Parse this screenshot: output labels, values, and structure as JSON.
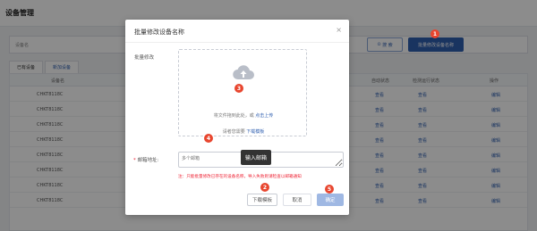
{
  "app": {
    "title": "设备管理",
    "filter_label": "设备名",
    "search_label": "搜 索",
    "batch_button_label": "批量修改设备名称",
    "tabs": [
      "已有设备",
      "新加设备"
    ],
    "table_header": [
      "设备名",
      "自动状态",
      "检测运行状态",
      "操作"
    ],
    "rows": [
      {
        "name": "CHKT8118C",
        "op": "编辑"
      },
      {
        "name": "CHKT8118C",
        "op": "编辑"
      },
      {
        "name": "CHKT8118C",
        "op": "编辑"
      },
      {
        "name": "CHKT8118C",
        "op": "编辑"
      },
      {
        "name": "CHKT8118C",
        "op": "编辑"
      },
      {
        "name": "CHKT8118C",
        "op": "编辑"
      },
      {
        "name": "CHKT8118C",
        "op": "编辑"
      },
      {
        "name": "CHKT8118C",
        "op": "编辑"
      }
    ],
    "status_link": "查看"
  },
  "dialog": {
    "title": "批量修改设备名称",
    "close_icon": "close-icon",
    "batch_label": "批量修改",
    "upload_text_prefix": "将文件拖到此处，或",
    "upload_link": "点击上传",
    "template_prefix": "请者您需要",
    "template_link": "下载模板",
    "email_label": "邮箱地址:",
    "email_placeholder": "多个邮箱",
    "tooltip": "输入邮箱",
    "note": "注：只能批量修改已存在的设备名称，导入失败则请检查以邮箱通知",
    "download_button": "下载模板",
    "cancel_button": "取消",
    "confirm_button": "确定"
  },
  "badges": [
    "1",
    "2",
    "3",
    "4",
    "5"
  ],
  "colors": {
    "primary": "#2f5fb0",
    "badge": "#e8462f",
    "confirm_disabled": "#9fb8e3",
    "note": "#e23"
  }
}
